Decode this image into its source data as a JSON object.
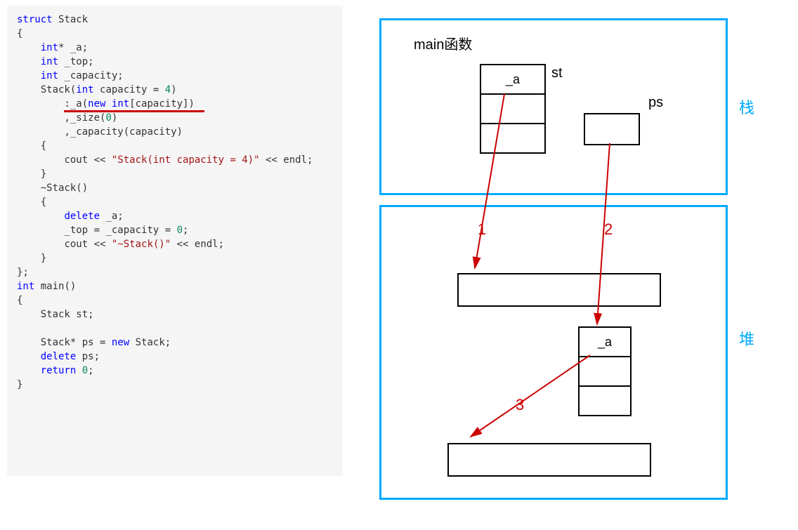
{
  "code": {
    "l1_struct": "struct",
    "l1_name": "Stack",
    "l2": "{",
    "l3_type": "int",
    "l3_rest": "* _a;",
    "l4_type": "int",
    "l4_rest": " _top;",
    "l5_type": "int",
    "l5_rest": " _capacity;",
    "l6_part1": "Stack(",
    "l6_type": "int",
    "l6_part2": " capacity = ",
    "l6_num": "4",
    "l6_part3": ")",
    "l7_part1": ":_a(",
    "l7_new": "new",
    "l7_type": "int",
    "l7_rest": "[capacity])",
    "l8": ",_size(",
    "l8_num": "0",
    "l8_end": ")",
    "l9": ",_capacity(capacity)",
    "l10": "{",
    "l11_part1": "cout << ",
    "l11_str": "\"Stack(int capacity = 4)\"",
    "l11_part2": " << endl;",
    "l12": "}",
    "l13": "~Stack()",
    "l14": "{",
    "l15_kw": "delete",
    "l15_rest": " _a;",
    "l16_part1": "_top = _capacity = ",
    "l16_num": "0",
    "l16_end": ";",
    "l17_part1": "cout << ",
    "l17_str": "\"~Stack()\"",
    "l17_part2": " << endl;",
    "l18": "}",
    "l19": "};",
    "blank": "",
    "l20_type": "int",
    "l20_rest": " main()",
    "l21": "{",
    "l22": "Stack st;",
    "l23_part1": "Stack* ps = ",
    "l23_new": "new",
    "l23_rest": " Stack;",
    "l24_kw": "delete",
    "l24_rest": " ps;",
    "l25_kw": "return",
    "l25_sp": " ",
    "l25_num": "0",
    "l25_end": ";",
    "l26": "}"
  },
  "diagram": {
    "main_fn_label": "main函数",
    "st_label": "st",
    "ps_label": "ps",
    "field_a": "_a",
    "field_a2": "_a",
    "stack_label_cn": "栈",
    "heap_label_cn": "堆",
    "arrow1_label": "1",
    "arrow2_label": "2",
    "arrow3_label": "3"
  }
}
